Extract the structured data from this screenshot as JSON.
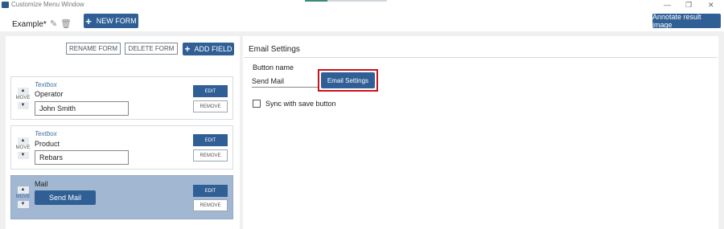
{
  "window": {
    "title": "Customize Menu Window",
    "controls": [
      "—",
      "❐",
      "✕"
    ]
  },
  "toolbar": {
    "tab_label": "Example*",
    "new_form_label": "NEW FORM",
    "annotate_label": "Annotate result image"
  },
  "left": {
    "rename_label": "RENAME FORM",
    "delete_label": "DELETE FORM",
    "add_field_label": "ADD FIELD",
    "move_label": "MOVE",
    "edit_label": "EDIT",
    "remove_label": "REMOVE",
    "fields": [
      {
        "type": "Textbox",
        "label": "Operator",
        "value": "John Smith"
      },
      {
        "type": "Textbox",
        "label": "Product",
        "value": "Rebars"
      },
      {
        "type": "",
        "label": "Mail",
        "button_text": "Send Mail"
      }
    ]
  },
  "right": {
    "section_title": "Email Settings",
    "button_name_label": "Button name",
    "button_name_value": "Send Mail",
    "email_settings_button": "Email Settings",
    "sync_label": "Sync with save button",
    "sync_checked": false
  },
  "colors": {
    "primary": "#2f5f95",
    "selected_card": "#a1b7d2",
    "highlight": "#c8141e"
  }
}
